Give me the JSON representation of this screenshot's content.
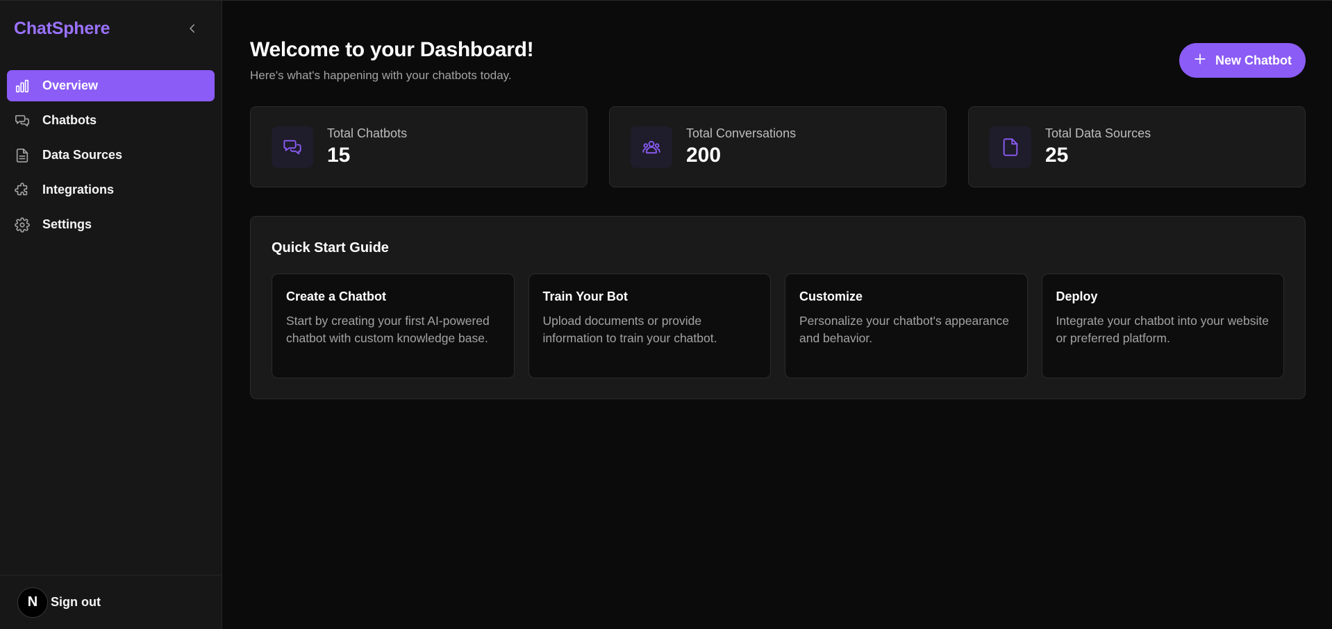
{
  "sidebar": {
    "brand": "ChatSphere",
    "collapse_icon": "chevron-left-icon",
    "items": [
      {
        "label": "Overview",
        "icon": "bar-chart-icon",
        "active": true
      },
      {
        "label": "Chatbots",
        "icon": "chat-bubbles-icon",
        "active": false
      },
      {
        "label": "Data Sources",
        "icon": "document-icon",
        "active": false
      },
      {
        "label": "Integrations",
        "icon": "puzzle-icon",
        "active": false
      },
      {
        "label": "Settings",
        "icon": "gear-icon",
        "active": false
      }
    ],
    "footer": {
      "avatar_letter": "N",
      "signout_label": "Sign out"
    }
  },
  "header": {
    "title": "Welcome to your Dashboard!",
    "subtitle": "Here's what's happening with your chatbots today.",
    "new_button_label": "New Chatbot"
  },
  "stats": [
    {
      "label": "Total Chatbots",
      "value": "15",
      "icon": "chat-bubbles-icon"
    },
    {
      "label": "Total Conversations",
      "value": "200",
      "icon": "users-icon"
    },
    {
      "label": "Total Data Sources",
      "value": "25",
      "icon": "document-icon"
    }
  ],
  "guide": {
    "title": "Quick Start Guide",
    "cards": [
      {
        "title": "Create a Chatbot",
        "desc": "Start by creating your first AI-powered chatbot with custom knowledge base."
      },
      {
        "title": "Train Your Bot",
        "desc": "Upload documents or provide information to train your chatbot."
      },
      {
        "title": "Customize",
        "desc": "Personalize your chatbot's appearance and behavior."
      },
      {
        "title": "Deploy",
        "desc": "Integrate your chatbot into your website or preferred platform."
      }
    ]
  },
  "colors": {
    "accent": "#8b5cf6",
    "brand": "#9b72ff",
    "background": "#0b0b0b",
    "sidebar": "#171717"
  }
}
